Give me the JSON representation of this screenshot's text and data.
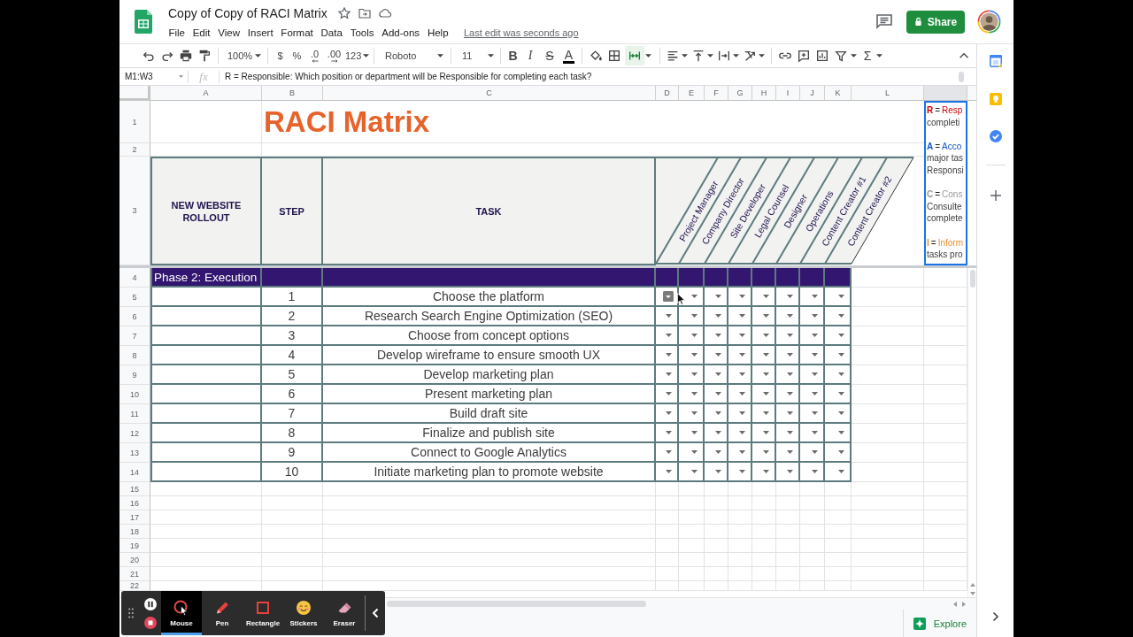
{
  "document": {
    "title": "Copy of Copy of RACI Matrix",
    "last_edit": "Last edit was seconds ago"
  },
  "menu": [
    "File",
    "Edit",
    "View",
    "Insert",
    "Format",
    "Data",
    "Tools",
    "Add-ons",
    "Help"
  ],
  "share_button": "Share",
  "toolbar": {
    "zoom": "100%",
    "currency": "$",
    "percent": "%",
    "decimal_decrease": ".0",
    "decimal_increase": ".00",
    "number_format": "123",
    "font": "Roboto",
    "font_size": "11",
    "bold": "B",
    "italic": "I",
    "strikethrough": "S",
    "text_color": "A",
    "merge_active": true,
    "functions": "Σ"
  },
  "formula_bar": {
    "name_box": "M1:W3",
    "fx": "fx",
    "formula": "R = Responsible: Which position or department will be Responsible for completing each task?"
  },
  "sheet": {
    "column_headers": [
      "A",
      "B",
      "C",
      "D",
      "E",
      "F",
      "G",
      "H",
      "I",
      "J",
      "K",
      "L"
    ],
    "row_numbers": [
      "1",
      "2",
      "3",
      "4",
      "5",
      "6",
      "7",
      "8",
      "9",
      "10",
      "11",
      "12",
      "13",
      "14",
      "15",
      "16",
      "17",
      "18",
      "19",
      "20",
      "21",
      "22"
    ],
    "title": "RACI Matrix",
    "headings": [
      "NEW WEBSITE ROLLOUT",
      "STEP",
      "TASK"
    ],
    "roles": [
      "Project Manager",
      "Company Director",
      "Site Developer",
      "Legal Counsel",
      "Designer",
      "Operations",
      "Content Creator #1",
      "Content Creator #2"
    ],
    "legend": {
      "selected": true,
      "entries": [
        {
          "letter": "R",
          "equals": "=",
          "term": "Resp",
          "color": "#cc0000",
          "lines": [
            "completi"
          ]
        },
        {
          "letter": "A",
          "equals": "=",
          "term": "Acco",
          "color": "#1155cc",
          "lines": [
            "major tas",
            "Responsi"
          ]
        },
        {
          "letter": "C",
          "equals": "=",
          "term": "Cons",
          "color": "#999999",
          "lines": [
            "Consulte",
            "complete"
          ]
        },
        {
          "letter": "I",
          "equals": "=",
          "term": "Inform",
          "color": "#e69138",
          "lines": [
            "tasks pro"
          ]
        }
      ]
    },
    "phase": "Phase 2: Execution",
    "tasks": [
      {
        "step": "1",
        "task": "Choose the platform",
        "dropdowns": [
          {
            "hovered": true
          },
          {
            "hovered": false
          },
          {
            "hovered": false
          },
          {
            "hovered": false
          },
          {
            "hovered": false
          },
          {
            "hovered": false
          },
          {
            "hovered": false
          },
          {
            "hovered": false
          }
        ]
      },
      {
        "step": "2",
        "task": "Research Search Engine Optimization (SEO)",
        "dropdowns": [
          {
            "hovered": false
          },
          {
            "hovered": false
          },
          {
            "hovered": false
          },
          {
            "hovered": false
          },
          {
            "hovered": false
          },
          {
            "hovered": false
          },
          {
            "hovered": false
          },
          {
            "hovered": false
          }
        ]
      },
      {
        "step": "3",
        "task": "Choose from concept options",
        "dropdowns": [
          {
            "hovered": false
          },
          {
            "hovered": false
          },
          {
            "hovered": false
          },
          {
            "hovered": false
          },
          {
            "hovered": false
          },
          {
            "hovered": false
          },
          {
            "hovered": false
          },
          {
            "hovered": false
          }
        ]
      },
      {
        "step": "4",
        "task": "Develop wireframe to ensure smooth UX",
        "dropdowns": [
          {
            "hovered": false
          },
          {
            "hovered": false
          },
          {
            "hovered": false
          },
          {
            "hovered": false
          },
          {
            "hovered": false
          },
          {
            "hovered": false
          },
          {
            "hovered": false
          },
          {
            "hovered": false
          }
        ]
      },
      {
        "step": "5",
        "task": "Develop marketing plan",
        "dropdowns": [
          {
            "hovered": false
          },
          {
            "hovered": false
          },
          {
            "hovered": false
          },
          {
            "hovered": false
          },
          {
            "hovered": false
          },
          {
            "hovered": false
          },
          {
            "hovered": false
          },
          {
            "hovered": false
          }
        ]
      },
      {
        "step": "6",
        "task": "Present marketing plan",
        "dropdowns": [
          {
            "hovered": false
          },
          {
            "hovered": false
          },
          {
            "hovered": false
          },
          {
            "hovered": false
          },
          {
            "hovered": false
          },
          {
            "hovered": false
          },
          {
            "hovered": false
          },
          {
            "hovered": false
          }
        ]
      },
      {
        "step": "7",
        "task": "Build draft site",
        "dropdowns": [
          {
            "hovered": false
          },
          {
            "hovered": false
          },
          {
            "hovered": false
          },
          {
            "hovered": false
          },
          {
            "hovered": false
          },
          {
            "hovered": false
          },
          {
            "hovered": false
          },
          {
            "hovered": false
          }
        ]
      },
      {
        "step": "8",
        "task": "Finalize and publish site",
        "dropdowns": [
          {
            "hovered": false
          },
          {
            "hovered": false
          },
          {
            "hovered": false
          },
          {
            "hovered": false
          },
          {
            "hovered": false
          },
          {
            "hovered": false
          },
          {
            "hovered": false
          },
          {
            "hovered": false
          }
        ]
      },
      {
        "step": "9",
        "task": "Connect to Google Analytics",
        "dropdowns": [
          {
            "hovered": false
          },
          {
            "hovered": false
          },
          {
            "hovered": false
          },
          {
            "hovered": false
          },
          {
            "hovered": false
          },
          {
            "hovered": false
          },
          {
            "hovered": false
          },
          {
            "hovered": false
          }
        ]
      },
      {
        "step": "10",
        "task": "Initiate marketing plan to promote website",
        "dropdowns": [
          {
            "hovered": false
          },
          {
            "hovered": false
          },
          {
            "hovered": false
          },
          {
            "hovered": false
          },
          {
            "hovered": false
          },
          {
            "hovered": false
          },
          {
            "hovered": false
          },
          {
            "hovered": false
          }
        ]
      }
    ]
  },
  "explore_button": "Explore",
  "recorder": {
    "tools": [
      {
        "kind": "mouse",
        "label": "Mouse",
        "selected": true
      },
      {
        "kind": "pen",
        "label": "Pen",
        "selected": false
      },
      {
        "kind": "rectangle",
        "label": "Rectangle",
        "selected": false
      },
      {
        "kind": "stickers",
        "label": "Stickers",
        "selected": false
      },
      {
        "kind": "eraser",
        "label": "Eraser",
        "selected": false
      }
    ]
  }
}
